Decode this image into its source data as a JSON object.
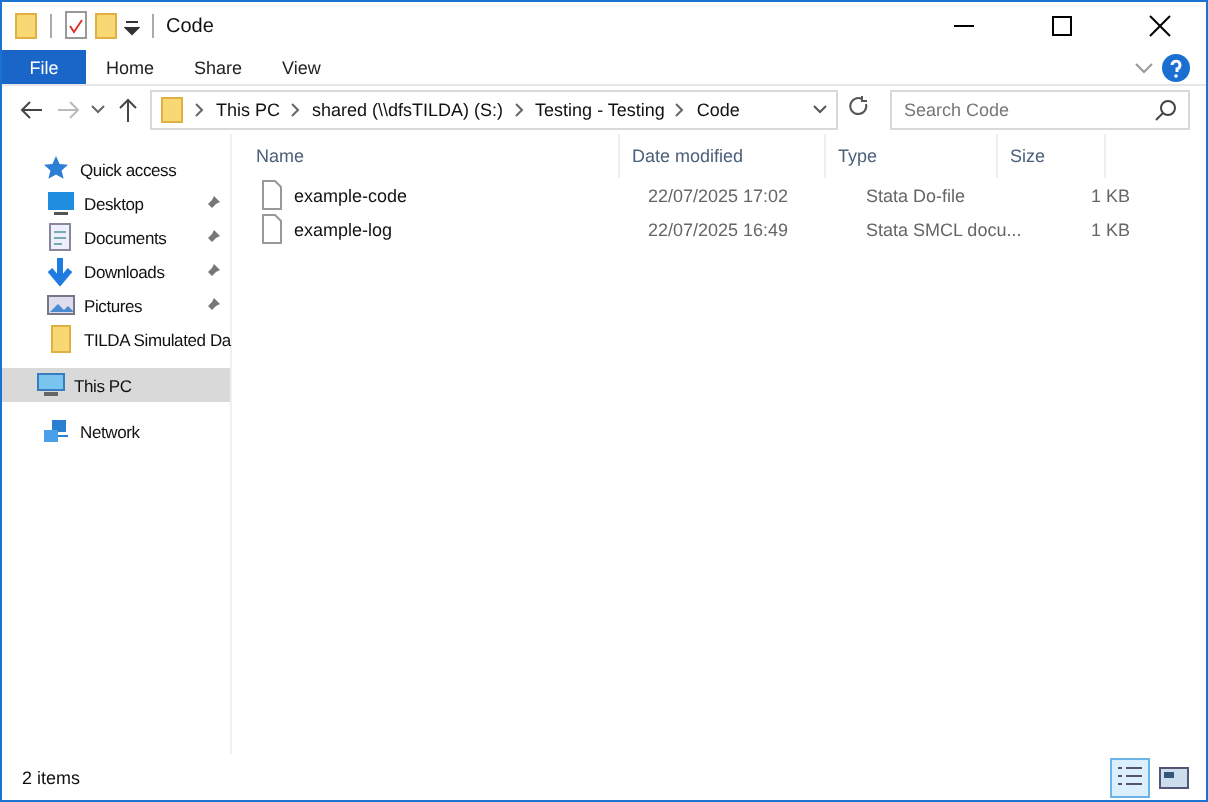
{
  "window": {
    "title": "Code"
  },
  "ribbon": {
    "file_button": "File",
    "tabs": [
      {
        "label": "Home",
        "selected": false
      },
      {
        "label": "Share",
        "selected": false
      },
      {
        "label": "View",
        "selected": false
      }
    ]
  },
  "address": {
    "path": [
      "This PC",
      "shared (\\\\dfsTILDA) (S:)",
      "Testing - Testing",
      "Code"
    ]
  },
  "search": {
    "placeholder": "Search Code"
  },
  "sidebar": {
    "items": [
      {
        "label": "Quick access",
        "kind": "star",
        "selected": false,
        "children": [
          {
            "label": "Desktop",
            "kind": "desktop",
            "pinned": true,
            "selected": false
          },
          {
            "label": "Documents",
            "kind": "documents",
            "pinned": true,
            "selected": false
          },
          {
            "label": "Downloads",
            "kind": "downloads",
            "pinned": true,
            "selected": false
          },
          {
            "label": "Pictures",
            "kind": "pictures",
            "pinned": true,
            "selected": false
          },
          {
            "label": "TILDA Simulated Da",
            "kind": "folder",
            "pinned": false,
            "selected": false
          }
        ]
      },
      {
        "label": "This PC",
        "kind": "computer",
        "selected": true
      },
      {
        "label": "Network",
        "kind": "network",
        "selected": false
      }
    ]
  },
  "table": {
    "columns": [
      "Name",
      "Date modified",
      "Type",
      "Size"
    ],
    "rows": [
      {
        "name": "example-code",
        "date": "22/07/2025 17:02",
        "type": "Stata Do-file",
        "size": "1 KB",
        "selected": false
      },
      {
        "name": "example-log",
        "date": "22/07/2025 16:49",
        "type": "Stata SMCL docu...",
        "size": "1 KB",
        "selected": false
      }
    ]
  },
  "status_bar": {
    "text": "2 items",
    "views": [
      {
        "kind": "details",
        "selected": true
      },
      {
        "kind": "tiles",
        "selected": false
      }
    ]
  }
}
